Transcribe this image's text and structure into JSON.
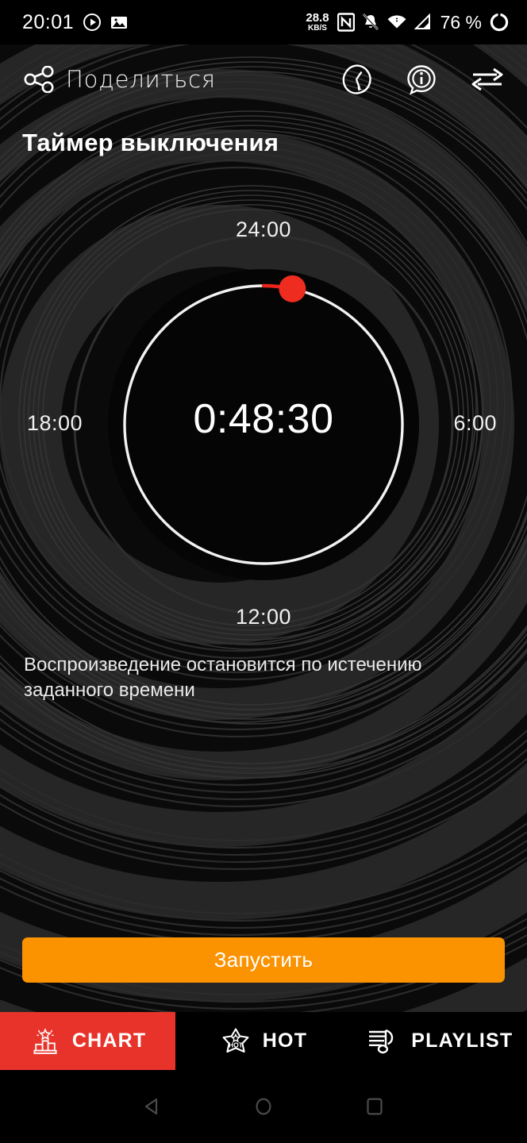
{
  "statusbar": {
    "clock": "20:01",
    "icons_left": [
      "play-circle-icon",
      "image-icon"
    ],
    "net_speed_value": "28.8",
    "net_speed_unit": "KB/S",
    "icons_right": [
      "nfc-icon",
      "notifications-muted-icon",
      "wifi-icon",
      "cellular-signal-icon"
    ],
    "battery_percent": "76 %",
    "battery_icon": "battery-ring-icon"
  },
  "appbar": {
    "share_icon": "share-nodes-icon",
    "share_label": "Поделиться",
    "actions": [
      {
        "name": "sleep-timer-icon",
        "label": ""
      },
      {
        "name": "info-bubble-icon",
        "label": ""
      },
      {
        "name": "swap-arrows-icon",
        "label": ""
      }
    ]
  },
  "page": {
    "title": "Таймер выключения",
    "description": "Воспроизведение остановится по истечению заданного времени"
  },
  "dial": {
    "center_time": "0:48:30",
    "label_top": "24:00",
    "label_right": "6:00",
    "label_bottom": "12:00",
    "label_left": "18:00",
    "knob_angle_deg": 12,
    "track_color": "#f2f2f2",
    "progress_color": "#e8241c",
    "knob_color": "#ee2c1f"
  },
  "primary_button": {
    "label": "Запустить",
    "color": "#fb9200"
  },
  "bottom_nav": {
    "active_color": "#e8332a",
    "items": [
      {
        "label": "CHART",
        "icon": "podium-chart-icon",
        "active": true
      },
      {
        "label": "HOT",
        "icon": "hot-star-icon",
        "active": false
      },
      {
        "label": "PLAYLIST",
        "icon": "playlist-note-icon",
        "active": false
      }
    ]
  },
  "android_nav": {
    "items": [
      {
        "icon": "back-triangle-icon"
      },
      {
        "icon": "home-circle-icon"
      },
      {
        "icon": "recents-square-icon"
      }
    ]
  }
}
